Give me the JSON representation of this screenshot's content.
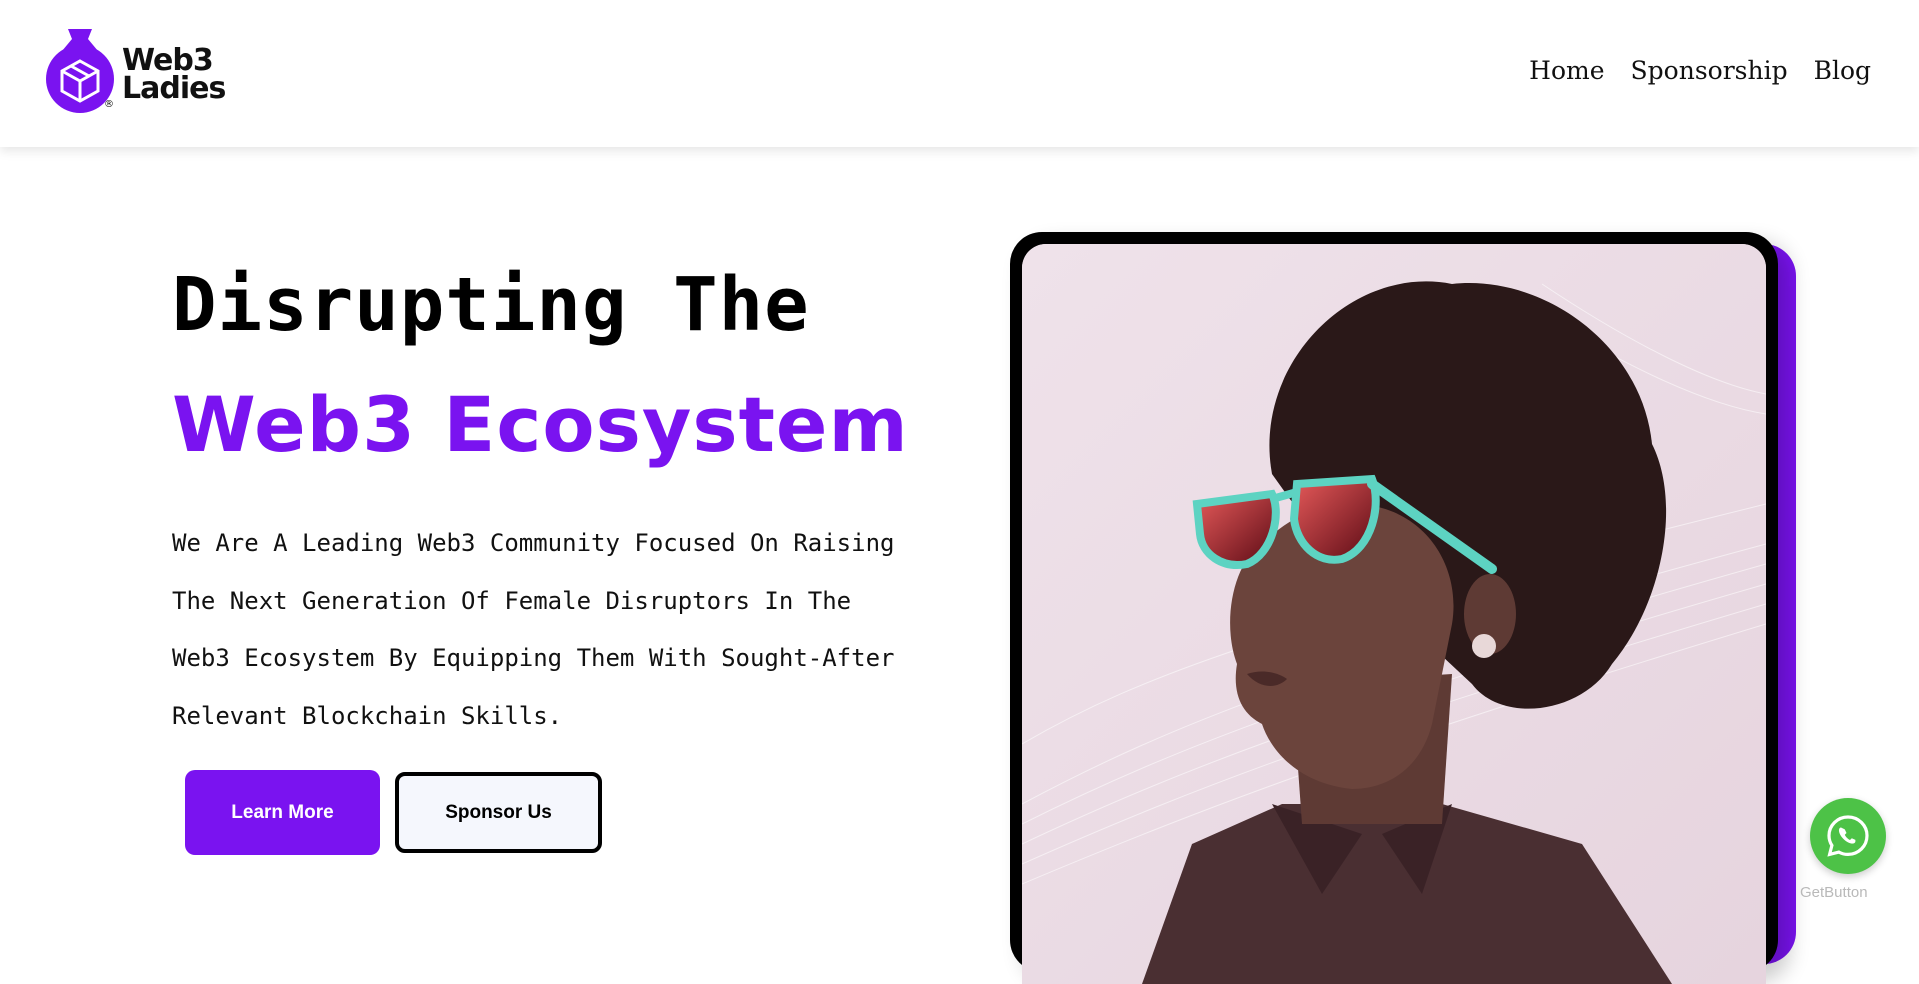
{
  "brand": {
    "line1": "Web3",
    "line2": "Ladies",
    "registered_mark": "®",
    "accent_color": "#7a13f0"
  },
  "nav": {
    "items": [
      {
        "label": "Home"
      },
      {
        "label": "Sponsorship"
      },
      {
        "label": "Blog"
      }
    ]
  },
  "hero": {
    "title_line1": "Disrupting The",
    "title_line2": "Web3 Ecosystem",
    "description": "We Are A Leading Web3 Community Focused On Raising The Next Generation Of Female Disruptors In The Web3 Ecosystem By Equipping Them With Sought-After Relevant Blockchain Skills.",
    "primary_button": "Learn More",
    "secondary_button": "Sponsor Us"
  },
  "widget": {
    "whatsapp_icon": "whatsapp-icon",
    "getbutton_label": "GetButton",
    "whatsapp_color": "#4dc247"
  }
}
